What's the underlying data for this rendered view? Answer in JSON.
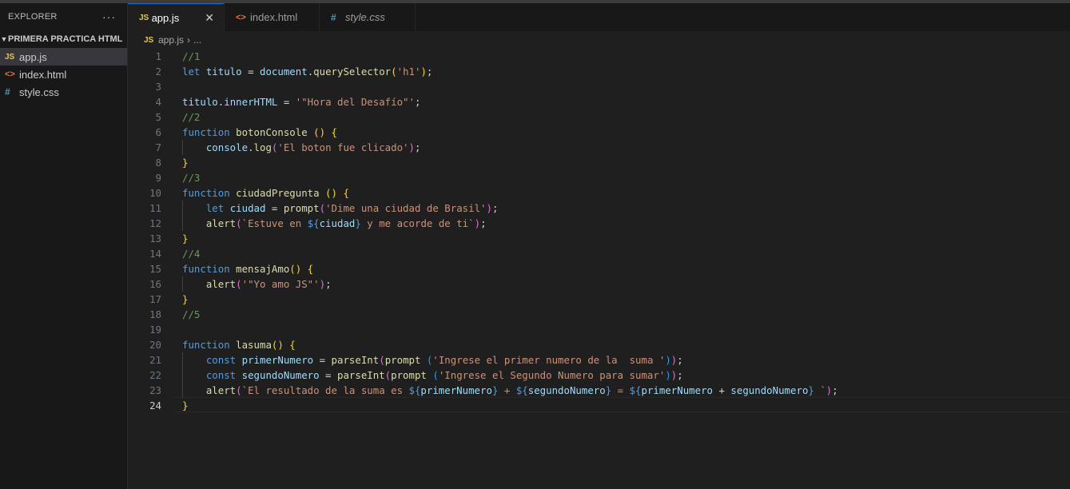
{
  "sidebar": {
    "title": "EXPLORER",
    "more": "···",
    "folder": "PRIMERA PRACTICA HTML",
    "files": [
      {
        "name": "app.js",
        "icon": "JS"
      },
      {
        "name": "index.html",
        "icon": "<>"
      },
      {
        "name": "style.css",
        "icon": "#"
      }
    ]
  },
  "tabs": [
    {
      "label": "app.js",
      "icon": "JS",
      "close": "✕"
    },
    {
      "label": "index.html",
      "icon": "<>"
    },
    {
      "label": "style.css",
      "icon": "#"
    }
  ],
  "breadcrumb": {
    "file": "app.js",
    "icon": "JS",
    "sep": "›",
    "rest": "..."
  },
  "lines": [
    [
      [
        "c-com",
        "//1"
      ]
    ],
    [
      [
        "c-kw",
        "let "
      ],
      [
        "c-var",
        "titulo"
      ],
      [
        "c-plain",
        " = "
      ],
      [
        "c-var",
        "document"
      ],
      [
        "c-plain",
        "."
      ],
      [
        "c-fn",
        "querySelector"
      ],
      [
        "c-br",
        "("
      ],
      [
        "c-str",
        "'h1'"
      ],
      [
        "c-br",
        ")"
      ],
      [
        "c-plain",
        ";"
      ]
    ],
    [],
    [
      [
        "c-var",
        "titulo"
      ],
      [
        "c-plain",
        "."
      ],
      [
        "c-var",
        "innerHTML"
      ],
      [
        "c-plain",
        " = "
      ],
      [
        "c-str",
        "'\"Hora del Desafío\"'"
      ],
      [
        "c-plain",
        ";"
      ]
    ],
    [
      [
        "c-com",
        "//2"
      ]
    ],
    [
      [
        "c-kw",
        "function "
      ],
      [
        "c-fn",
        "botonConsole "
      ],
      [
        "c-br",
        "()"
      ],
      [
        "c-plain",
        " "
      ],
      [
        "c-br",
        "{"
      ]
    ],
    [
      [
        "c-plain",
        "    "
      ],
      [
        "c-var",
        "console"
      ],
      [
        "c-plain",
        "."
      ],
      [
        "c-fn",
        "log"
      ],
      [
        "c-br2",
        "("
      ],
      [
        "c-str",
        "'El boton fue clicado'"
      ],
      [
        "c-br2",
        ")"
      ],
      [
        "c-plain",
        ";"
      ]
    ],
    [
      [
        "c-br",
        "}"
      ]
    ],
    [
      [
        "c-com",
        "//3"
      ]
    ],
    [
      [
        "c-kw",
        "function "
      ],
      [
        "c-fn",
        "ciudadPregunta "
      ],
      [
        "c-br",
        "()"
      ],
      [
        "c-plain",
        " "
      ],
      [
        "c-br",
        "{"
      ]
    ],
    [
      [
        "c-plain",
        "    "
      ],
      [
        "c-kw",
        "let "
      ],
      [
        "c-var",
        "ciudad"
      ],
      [
        "c-plain",
        " = "
      ],
      [
        "c-fn",
        "prompt"
      ],
      [
        "c-br2",
        "("
      ],
      [
        "c-str",
        "'Dime una ciudad de Brasil'"
      ],
      [
        "c-br2",
        ")"
      ],
      [
        "c-plain",
        ";"
      ]
    ],
    [
      [
        "c-plain",
        "    "
      ],
      [
        "c-fn",
        "alert"
      ],
      [
        "c-br2",
        "("
      ],
      [
        "c-str",
        "`Estuve en "
      ],
      [
        "c-tmpl",
        "${"
      ],
      [
        "c-var",
        "ciudad"
      ],
      [
        "c-tmpl",
        "}"
      ],
      [
        "c-str",
        " y me acorde de ti`"
      ],
      [
        "c-br2",
        ")"
      ],
      [
        "c-plain",
        ";"
      ]
    ],
    [
      [
        "c-br",
        "}"
      ]
    ],
    [
      [
        "c-com",
        "//4"
      ]
    ],
    [
      [
        "c-kw",
        "function "
      ],
      [
        "c-fn",
        "mensajAmo"
      ],
      [
        "c-br",
        "()"
      ],
      [
        "c-plain",
        " "
      ],
      [
        "c-br",
        "{"
      ]
    ],
    [
      [
        "c-plain",
        "    "
      ],
      [
        "c-fn",
        "alert"
      ],
      [
        "c-br2",
        "("
      ],
      [
        "c-str",
        "'\"Yo amo JS\"'"
      ],
      [
        "c-br2",
        ")"
      ],
      [
        "c-plain",
        ";"
      ]
    ],
    [
      [
        "c-br",
        "}"
      ]
    ],
    [
      [
        "c-com",
        "//5"
      ]
    ],
    [],
    [
      [
        "c-kw",
        "function "
      ],
      [
        "c-fn",
        "lasuma"
      ],
      [
        "c-br",
        "()"
      ],
      [
        "c-plain",
        " "
      ],
      [
        "c-br",
        "{"
      ]
    ],
    [
      [
        "c-plain",
        "    "
      ],
      [
        "c-kw",
        "const "
      ],
      [
        "c-var",
        "primerNumero"
      ],
      [
        "c-plain",
        " = "
      ],
      [
        "c-fn",
        "parseInt"
      ],
      [
        "c-br2",
        "("
      ],
      [
        "c-fn",
        "prompt"
      ],
      [
        "c-plain",
        " "
      ],
      [
        "c-br3",
        "("
      ],
      [
        "c-str",
        "'Ingrese el primer numero de la  suma '"
      ],
      [
        "c-br3",
        ")"
      ],
      [
        "c-br2",
        ")"
      ],
      [
        "c-plain",
        ";"
      ]
    ],
    [
      [
        "c-plain",
        "    "
      ],
      [
        "c-kw",
        "const "
      ],
      [
        "c-var",
        "segundoNumero"
      ],
      [
        "c-plain",
        " = "
      ],
      [
        "c-fn",
        "parseInt"
      ],
      [
        "c-br2",
        "("
      ],
      [
        "c-fn",
        "prompt"
      ],
      [
        "c-plain",
        " "
      ],
      [
        "c-br3",
        "("
      ],
      [
        "c-str",
        "'Ingrese el Segundo Numero para sumar'"
      ],
      [
        "c-br3",
        ")"
      ],
      [
        "c-br2",
        ")"
      ],
      [
        "c-plain",
        ";"
      ]
    ],
    [
      [
        "c-plain",
        "    "
      ],
      [
        "c-fn",
        "alert"
      ],
      [
        "c-br2",
        "("
      ],
      [
        "c-str",
        "`El resultado de la suma es "
      ],
      [
        "c-tmpl",
        "${"
      ],
      [
        "c-var",
        "primerNumero"
      ],
      [
        "c-tmpl",
        "}"
      ],
      [
        "c-str",
        " + "
      ],
      [
        "c-tmpl",
        "${"
      ],
      [
        "c-var",
        "segundoNumero"
      ],
      [
        "c-tmpl",
        "}"
      ],
      [
        "c-str",
        " = "
      ],
      [
        "c-tmpl",
        "${"
      ],
      [
        "c-var",
        "primerNumero"
      ],
      [
        "c-plain",
        " + "
      ],
      [
        "c-var",
        "segundoNumero"
      ],
      [
        "c-tmpl",
        "}"
      ],
      [
        "c-str",
        " `"
      ],
      [
        "c-br2",
        ")"
      ],
      [
        "c-plain",
        ";"
      ]
    ],
    [
      [
        "c-br",
        "}"
      ]
    ]
  ],
  "current_line": 24
}
